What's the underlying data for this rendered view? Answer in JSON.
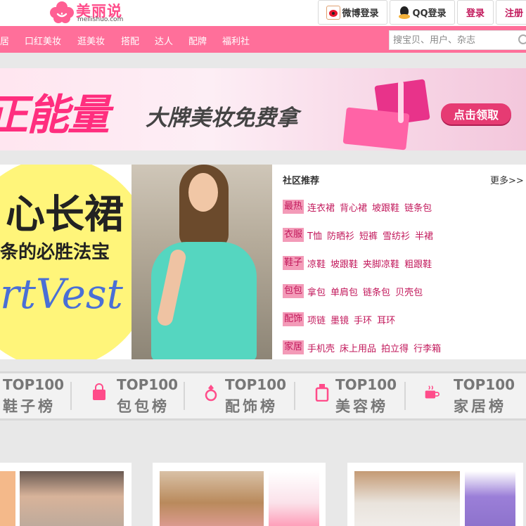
{
  "header": {
    "logo_cn": "美丽说",
    "logo_en": "meilishuo.com",
    "weibo_login": "微博登录",
    "qq_login": "QQ登录",
    "login": "登录",
    "register": "注册"
  },
  "nav": {
    "items": [
      "居",
      "口红美妆",
      "逛美妆",
      "搭配",
      "达人",
      "配牌",
      "福利社"
    ],
    "search_placeholder": "搜宝贝、用户、杂志"
  },
  "banner": {
    "headline": "正能量",
    "subline": "大牌美妆免费拿",
    "button": "点击领取"
  },
  "hero": {
    "title": "心长裙",
    "subtitle": "条的必胜法宝",
    "script": "rtVest"
  },
  "community": {
    "title": "社区推荐",
    "more": "更多>>",
    "rows": [
      {
        "tag": "最热",
        "links": [
          "连衣裙",
          "背心裙",
          "坡跟鞋",
          "链条包"
        ]
      },
      {
        "tag": "衣服",
        "links": [
          "T恤",
          "防晒衫",
          "短裤",
          "雪纺衫",
          "半裙"
        ]
      },
      {
        "tag": "鞋子",
        "links": [
          "凉鞋",
          "坡跟鞋",
          "夹脚凉鞋",
          "粗跟鞋"
        ]
      },
      {
        "tag": "包包",
        "links": [
          "拿包",
          "单肩包",
          "链条包",
          "贝壳包"
        ]
      },
      {
        "tag": "配饰",
        "links": [
          "项链",
          "墨镜",
          "手环",
          "耳环"
        ]
      },
      {
        "tag": "家居",
        "links": [
          "手机壳",
          "床上用品",
          "拍立得",
          "行李箱"
        ]
      }
    ]
  },
  "top100": [
    {
      "top": "TOP100",
      "name": "鞋子榜",
      "icon": "shoe-icon"
    },
    {
      "top": "TOP100",
      "name": "包包榜",
      "icon": "bag-icon"
    },
    {
      "top": "TOP100",
      "name": "配饰榜",
      "icon": "ring-icon"
    },
    {
      "top": "TOP100",
      "name": "美容榜",
      "icon": "bottle-icon"
    },
    {
      "top": "TOP100",
      "name": "家居榜",
      "icon": "cup-icon"
    }
  ],
  "colors": {
    "brand_pink": "#ff6f9a",
    "link_pink": "#c2185b",
    "tag_bg": "#f39bb8"
  }
}
